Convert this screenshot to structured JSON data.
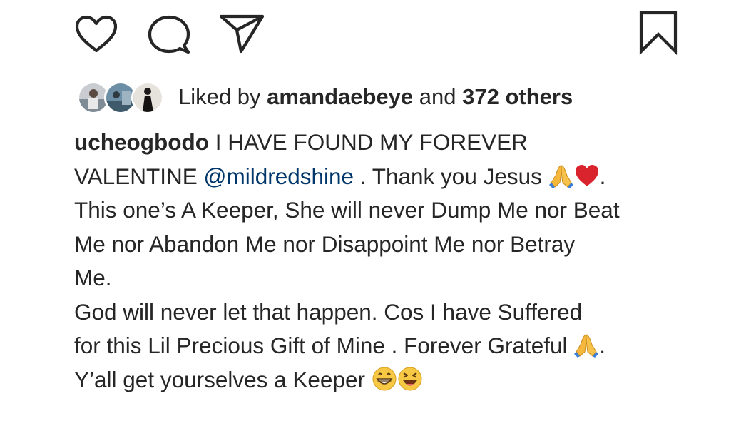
{
  "actions": {
    "like_icon": "heart-icon",
    "comment_icon": "comment-bubble-icon",
    "share_icon": "paper-plane-icon",
    "save_icon": "bookmark-icon"
  },
  "likes": {
    "prefix": "Liked by",
    "first_user": "amandaebeye",
    "conjunction": "and",
    "others": "372 others"
  },
  "caption": {
    "username": "ucheogbodo",
    "line1_text": "I HAVE FOUND MY FOREVER",
    "line2_pre": "VALENTINE",
    "mention": "@mildredshine",
    "line2_post": ". Thank you Jesus",
    "line2_end": ".",
    "line3": "This one’s A Keeper, She will never Dump Me nor Beat",
    "line4": "Me nor Abandon Me nor Disappoint Me nor Betray",
    "line5": "Me.",
    "line6": "God will never let that happen. Cos I have Suffered",
    "line7_pre": "for this Lil Precious Gift of Mine . Forever Grateful",
    "line7_end": ".",
    "line8": "Y’all get yourselves a Keeper"
  },
  "colors": {
    "text": "#262626",
    "mention": "#00376b",
    "heart_emoji": "#d9232d"
  }
}
